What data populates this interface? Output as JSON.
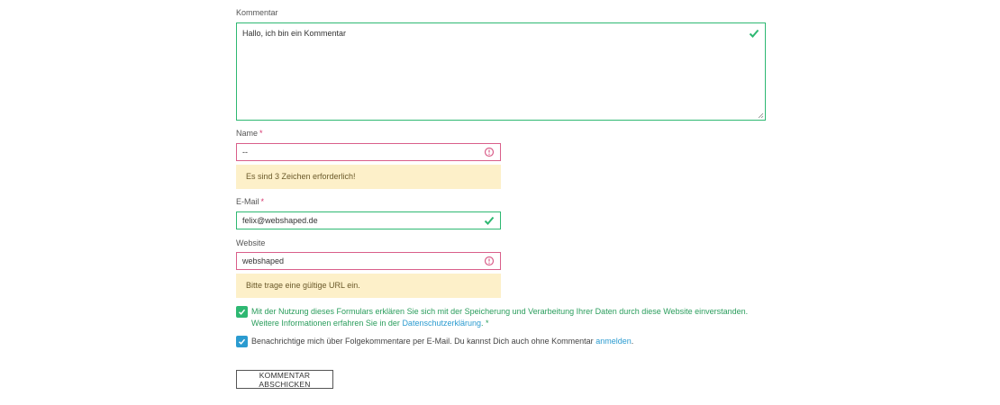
{
  "form": {
    "comment": {
      "label": "Kommentar",
      "value": "Hallo, ich bin ein Kommentar",
      "status": "valid"
    },
    "name": {
      "label": "Name",
      "required_mark": "*",
      "value": "--",
      "status": "error",
      "error": "Es sind 3 Zeichen erforderlich!"
    },
    "email": {
      "label": "E-Mail",
      "required_mark": "*",
      "value": "felix@webshaped.de",
      "status": "valid"
    },
    "website": {
      "label": "Website",
      "value": "webshaped",
      "status": "error",
      "error": "Bitte trage eine gültige URL ein."
    },
    "privacy": {
      "checked": true,
      "text_before": "Mit der Nutzung dieses Formulars erklären Sie sich mit der Speicherung und Verarbeitung Ihrer Daten durch diese Website einverstanden. Weitere Informationen erfahren Sie in der ",
      "link": "Datenschutzerklärung",
      "text_after": ". *"
    },
    "subscribe": {
      "checked": true,
      "text_before": "Benachrichtige mich über Folgekommentare per E-Mail. Du kannst Dich auch ohne Kommentar ",
      "link": "anmelden",
      "text_after": "."
    },
    "submit_label": "KOMMENTAR ABSCHICKEN"
  },
  "colors": {
    "valid": "#2eb872",
    "error": "#d95f8a",
    "notice_bg": "#fdf0c9",
    "link": "#2b9bd0"
  },
  "icons": {
    "valid": "check-icon",
    "error": "alert-circle-icon",
    "checkbox": "checkmark-icon"
  }
}
